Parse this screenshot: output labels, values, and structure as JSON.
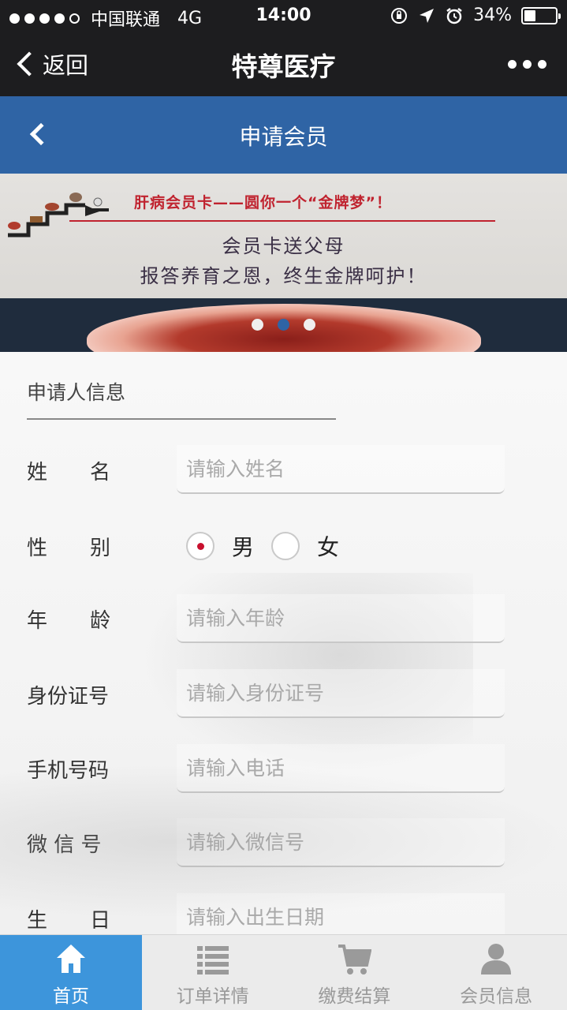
{
  "status_bar": {
    "carrier": "中国联通",
    "network": "4G",
    "time": "14:00",
    "battery": "34%",
    "battery_level": 0.34
  },
  "nav": {
    "back_label": "返回",
    "title": "特尊医疗"
  },
  "page": {
    "title": "申请会员"
  },
  "banner": {
    "headline": "肝病会员卡——圆你一个“金牌梦”！",
    "line1": "会员卡送父母",
    "line2": "报答养育之恩，终生金牌呵护！",
    "slides": 3,
    "active_slide": 2
  },
  "form": {
    "section_title": "申请人信息",
    "name": {
      "label_chars": [
        "姓",
        "名"
      ],
      "placeholder": "请输入姓名"
    },
    "gender": {
      "label_chars": [
        "性",
        "别"
      ],
      "options": [
        "男",
        "女"
      ],
      "selected": "男"
    },
    "age": {
      "label_chars": [
        "年",
        "龄"
      ],
      "placeholder": "请输入年龄"
    },
    "id_number": {
      "label": "身份证号",
      "placeholder": "请输入身份证号"
    },
    "phone": {
      "label": "手机号码",
      "placeholder": "请输入电话"
    },
    "wechat": {
      "label": "微 信 号",
      "placeholder": "请输入微信号"
    },
    "birthday": {
      "label_chars": [
        "生",
        "日"
      ],
      "placeholder": "请输入出生日期"
    }
  },
  "tabs": [
    {
      "label": "首页",
      "icon": "home-icon",
      "active": true
    },
    {
      "label": "订单详情",
      "icon": "list-icon",
      "active": false
    },
    {
      "label": "缴费结算",
      "icon": "cart-icon",
      "active": false
    },
    {
      "label": "会员信息",
      "icon": "user-icon",
      "active": false
    }
  ],
  "colors": {
    "header_blue": "#2f64a5",
    "tab_active": "#3d95db",
    "radio_selected": "#c8102e"
  }
}
